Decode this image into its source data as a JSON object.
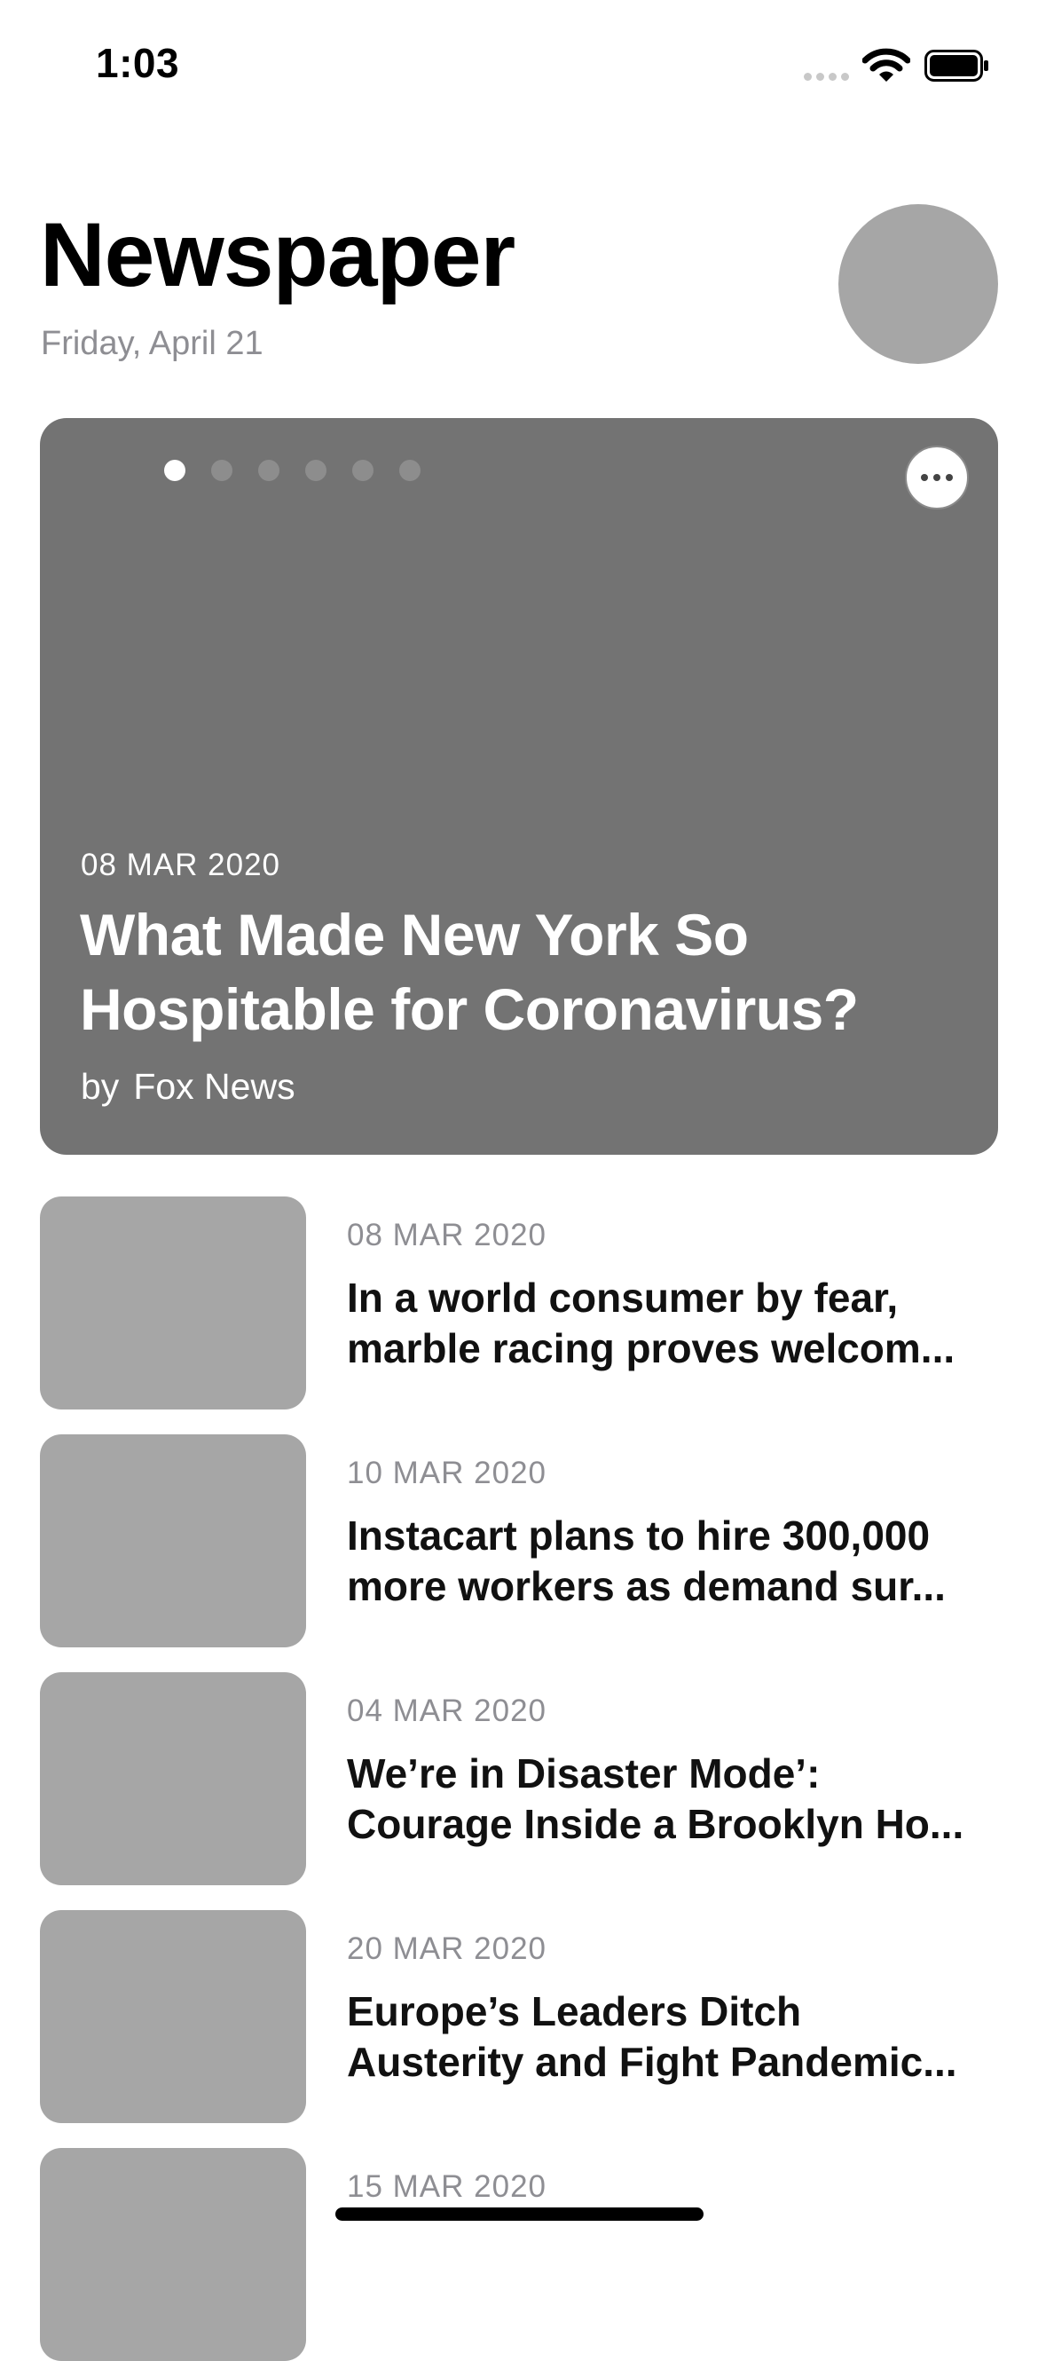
{
  "status_bar": {
    "time": "1:03"
  },
  "header": {
    "title": "Newspaper",
    "date": "Friday, April 21"
  },
  "hero": {
    "date": "08 MAR 2020",
    "title_lines": [
      "What Made New York So",
      "Hospitable for Coronavirus?"
    ],
    "by_label": "by",
    "source": "Fox News",
    "page_count": 6,
    "active_page": 1,
    "more_icon": "ellipsis-icon"
  },
  "articles": [
    {
      "date": "08 MAR 2020",
      "lines": [
        "In a world consumer by fear,",
        "marble racing proves welcom..."
      ]
    },
    {
      "date": "10 MAR 2020",
      "lines": [
        "Instacart plans to hire 300,000",
        "more workers as demand sur..."
      ]
    },
    {
      "date": "04 MAR 2020",
      "lines": [
        "We’re in Disaster Mode’:",
        "Courage Inside a Brooklyn Ho..."
      ]
    },
    {
      "date": "20 MAR 2020",
      "lines": [
        "Europe’s Leaders Ditch",
        "Austerity and Fight Pandemic..."
      ]
    },
    {
      "date": "15 MAR 2020",
      "lines": [
        "",
        ""
      ]
    }
  ],
  "colors": {
    "hero_background": "#737373",
    "placeholder": "#a6a6a6",
    "secondary_text": "#8e8e93"
  }
}
